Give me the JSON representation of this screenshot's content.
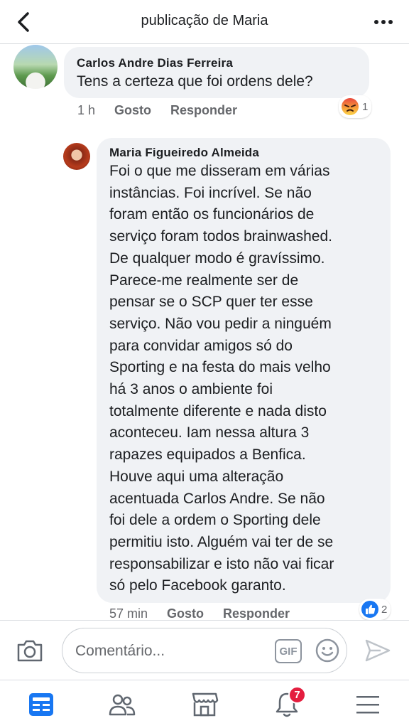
{
  "header": {
    "title": "publicação de Maria",
    "back_icon": "chevron-left-icon",
    "more_icon": "more-horizontal-icon"
  },
  "comments": [
    {
      "author": "Carlos Andre Dias Ferreira",
      "text": "Tens a certeza que foi ordens dele?",
      "time": "1 h",
      "like_label": "Gosto",
      "reply_label": "Responder",
      "reaction": {
        "icon": "angry-reaction-icon",
        "count": "1"
      }
    },
    {
      "author": "Maria Figueiredo Almeida",
      "text_lines": [
        "Foi o que me disseram em várias",
        "instâncias. Foi incrível. Se não",
        "foram então os funcionários de",
        "serviço foram todos brainwashed.",
        "De qualquer modo é gravíssimo.",
        "Parece-me realmente ser de",
        "pensar se o SCP quer ter esse",
        "serviço. Não vou pedir a ninguém",
        "para convidar amigos só do",
        "Sporting e na festa do mais velho",
        "há 3 anos o ambiente foi",
        "totalmente diferente e nada disto",
        "aconteceu. Iam nessa altura 3",
        "rapazes equipados a Benfica.",
        "Houve aqui uma alteração",
        "acentuada Carlos Andre. Se não",
        "foi dele a ordem o Sporting dele",
        "permitiu isto. Alguém vai ter de se",
        "responsabilizar e isto não vai ficar",
        "só pelo Facebook garanto."
      ],
      "time": "57 min",
      "like_label": "Gosto",
      "reply_label": "Responder",
      "reaction": {
        "icon": "like-reaction-icon",
        "count": "2"
      }
    }
  ],
  "composer": {
    "placeholder": "Comentário...",
    "gif_label": "GIF",
    "camera_icon": "camera-icon",
    "emoji_icon": "emoji-icon",
    "send_icon": "send-icon"
  },
  "bottom_nav": {
    "items": [
      "news-feed-icon",
      "friends-icon",
      "marketplace-icon",
      "notifications-icon",
      "menu-icon"
    ],
    "notifications_badge": "7"
  },
  "colors": {
    "accent": "#1877f2",
    "bubble": "#f0f2f5",
    "secondary_text": "#65676b",
    "badge": "#e41e3f"
  }
}
